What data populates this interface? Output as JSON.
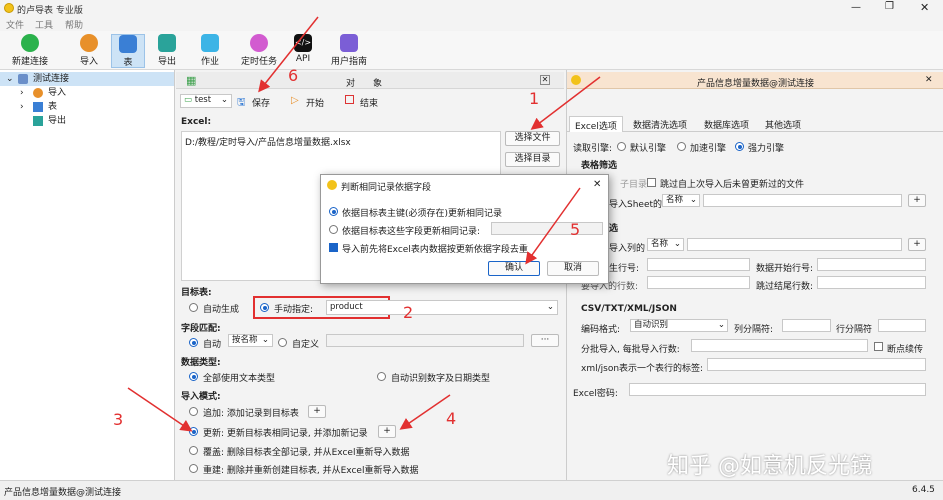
{
  "window": {
    "title": "的卢导表 专业版",
    "version": "6.4.5"
  },
  "menu": [
    "文件",
    "工具",
    "帮助"
  ],
  "toolbar": {
    "new_conn": "新建连接",
    "import": "导入",
    "table": "表",
    "export": "导出",
    "job": "作业",
    "scheduled": "定时任务",
    "api": "API",
    "guide": "用户指南"
  },
  "tree": {
    "root": "测试连接",
    "items": [
      "导入",
      "表",
      "导出"
    ]
  },
  "mid": {
    "tab_title": "对　　象",
    "toolbar": {
      "profile": "test",
      "save": "保存",
      "start": "开始",
      "stop": "结束"
    },
    "excel_label": "Excel:",
    "excel_path": "D:/教程/定时导入/产品信息增量数据.xlsx",
    "select_file": "选择文件",
    "select_dir": "选择目录",
    "target_label": "目标表:",
    "auto_gen": "自动生成",
    "manual": "手动指定:",
    "target_value": "product",
    "field_match": "字段匹配:",
    "auto": "自动",
    "by_name": "按名称",
    "custom": "自定义",
    "more": "···",
    "datatype": "数据类型:",
    "all_text": "全部使用文本类型",
    "auto_detect": "自动识别数字及日期类型",
    "mode": "导入模式:",
    "append": "追加: 添加记录到目标表",
    "update": "更新: 更新目标表相同记录, 并添加新记录",
    "overwrite": "覆盖: 删除目标表全部记录, 并从Excel重新导入数据",
    "rebuild": "重建: 删除并重新创建目标表, 并从Excel重新导入数据",
    "plus": "+"
  },
  "right": {
    "header": "产品信息增量数据@测试连接",
    "tabs": [
      "Excel选项",
      "数据清洗选项",
      "数据库选项",
      "其他选项"
    ],
    "engine_label": "读取引擎:",
    "engines": [
      "默认引擎",
      "加速引擎",
      "强力引擎"
    ],
    "table_filter": "表格筛选",
    "subdir": "子目录",
    "skip_unchanged": "跳过自上次导入后未曾更新过的文件",
    "sheet_label": "导入Sheet的",
    "by_name": "名称",
    "col_section": "选",
    "col_label": "导入列的",
    "header_row": "生行号:",
    "data_start": "数据开始行号:",
    "skip_rows": "要导入的行数:",
    "data_end": "跳过结尾行数:",
    "csv_section": "CSV/TXT/XML/JSON",
    "encoding_label": "编码格式:",
    "encoding_value": "自动识别",
    "col_sep": "列分隔符:",
    "row_sep": "行分隔符",
    "batch": "分批导入, 每批导入行数:",
    "resume": "断点续传",
    "xml_tag": "xml/json表示一个表行的标签:",
    "excel_pwd": "Excel密码:"
  },
  "dialog": {
    "title": "判断相同记录依据字段",
    "opt1": "依据目标表主键(必须存在)更新相同记录",
    "opt2": "依据目标表这些字段更新相同记录:",
    "opt3": "导入前先将Excel表内数据按更新依据字段去重",
    "ok": "确认",
    "cancel": "取消"
  },
  "annotations": [
    "1",
    "2",
    "3",
    "4",
    "5",
    "6"
  ],
  "watermark": "知乎 @如意机反光镜",
  "status": "产品信息增量数据@测试连接",
  "colors": {
    "accent": "#1a64c8",
    "annotation": "#e23030",
    "selected": "#cde3f6"
  }
}
